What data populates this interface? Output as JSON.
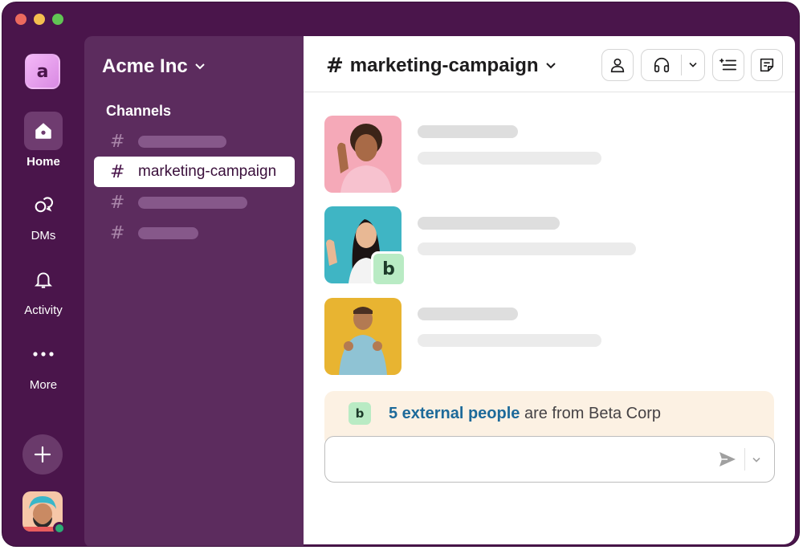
{
  "workspace": {
    "name": "Acme Inc",
    "logo_letter": "a"
  },
  "rail": {
    "items": [
      {
        "label": "Home"
      },
      {
        "label": "DMs"
      },
      {
        "label": "Activity"
      },
      {
        "label": "More"
      }
    ]
  },
  "sidebar": {
    "section_title": "Channels",
    "channels": [
      {
        "name": ""
      },
      {
        "name": "marketing-campaign"
      },
      {
        "name": ""
      },
      {
        "name": ""
      }
    ]
  },
  "channel_header": {
    "title": "marketing-campaign"
  },
  "external_badge_letter": "b",
  "external_banner": {
    "link_text": "5 external people",
    "rest_text": " are from Beta Corp"
  },
  "colors": {
    "rail_bg": "#4a154b",
    "sidebar_bg": "#5c2c5e",
    "link": "#1d6a9a",
    "banner_bg": "#fcf1e3",
    "external_badge": "#b9ebc4",
    "presence": "#2bac76"
  }
}
